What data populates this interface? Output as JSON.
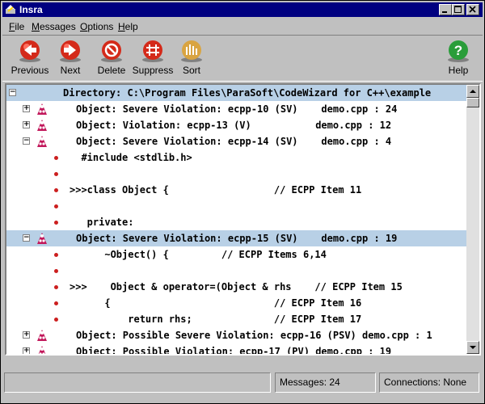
{
  "window": {
    "title": "Insra"
  },
  "menu": [
    {
      "label": "File",
      "mnemonic": "F",
      "rest": "ile"
    },
    {
      "label": "Messages",
      "mnemonic": "M",
      "rest": "essages"
    },
    {
      "label": "Options",
      "mnemonic": "O",
      "rest": "ptions"
    },
    {
      "label": "Help",
      "mnemonic": "H",
      "rest": "elp"
    }
  ],
  "toolbar": {
    "previous": "Previous",
    "next": "Next",
    "delete": "Delete",
    "suppress": "Suppress",
    "sort": "Sort",
    "help": "Help"
  },
  "directory": "Directory: C:\\Program Files\\ParaSoft\\CodeWizard for C++\\example",
  "rows": [
    {
      "kind": "object",
      "expander": "+",
      "text": "Object: Severe Violation: ecpp-10 (SV)    demo.cpp : 24"
    },
    {
      "kind": "object",
      "expander": "+",
      "text": "Object: Violation: ecpp-13 (V)           demo.cpp : 12"
    },
    {
      "kind": "object",
      "expander": "-",
      "text": "Object: Severe Violation: ecpp-14 (SV)    demo.cpp : 4"
    },
    {
      "kind": "code",
      "text": "  #include <stdlib.h>"
    },
    {
      "kind": "code",
      "text": ""
    },
    {
      "kind": "code",
      "text": ">>>class Object {                  // ECPP Item 11"
    },
    {
      "kind": "code",
      "text": ""
    },
    {
      "kind": "code",
      "text": "   private:"
    },
    {
      "kind": "object",
      "expander": "-",
      "selected": true,
      "text": "Object: Severe Violation: ecpp-15 (SV)    demo.cpp : 19"
    },
    {
      "kind": "code",
      "text": "      ~Object() {         // ECPP Items 6,14"
    },
    {
      "kind": "code",
      "text": ""
    },
    {
      "kind": "code",
      "text": ">>>    Object & operator=(Object & rhs    // ECPP Item 15"
    },
    {
      "kind": "code",
      "text": "      {                            // ECPP Item 16"
    },
    {
      "kind": "code",
      "text": "          return rhs;              // ECPP Item 17"
    },
    {
      "kind": "object",
      "expander": "+",
      "text": "Object: Possible Severe Violation: ecpp-16 (PSV) demo.cpp : 1"
    },
    {
      "kind": "object",
      "expander": "+",
      "text": "Object: Possible Violation: ecpp-17 (PV) demo.cpp : 19"
    }
  ],
  "status": {
    "messages": "Messages: 24",
    "connections": "Connections: None"
  },
  "colors": {
    "titlebar": "#000080",
    "selection": "#b8d0e6",
    "marker": "#cc1f1f"
  }
}
